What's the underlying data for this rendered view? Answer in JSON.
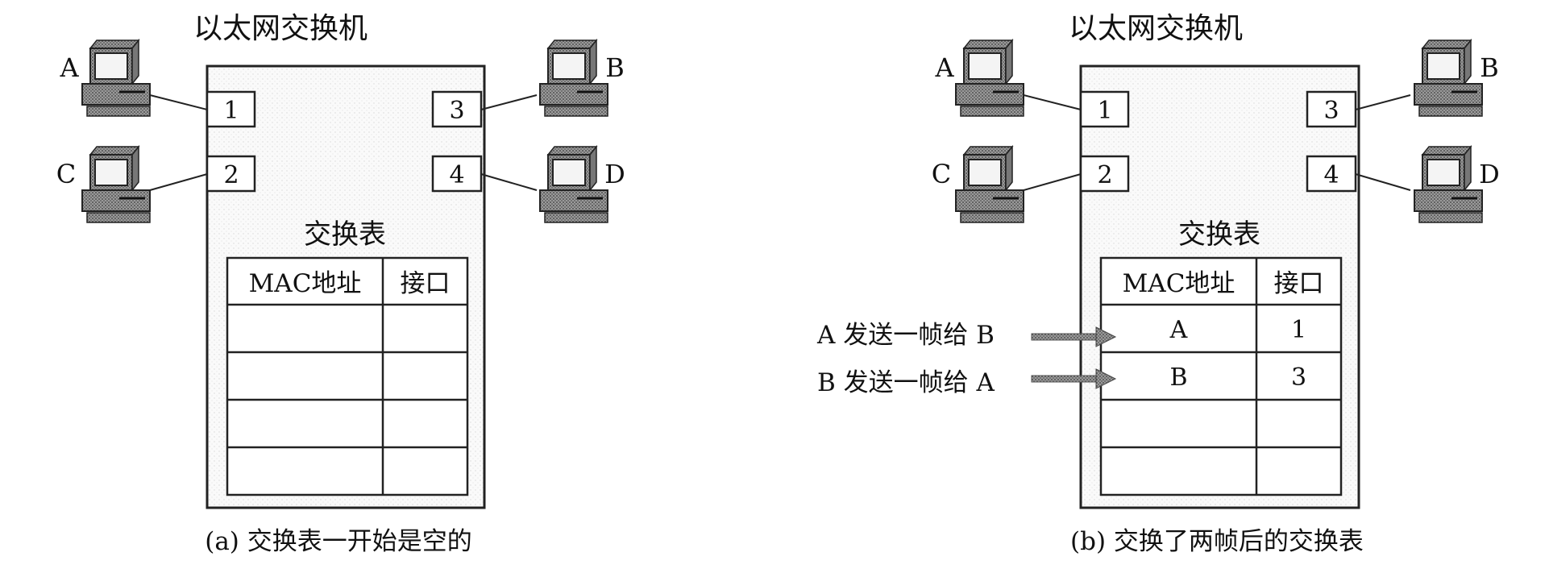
{
  "panels": [
    {
      "switch_title": "以太网交换机",
      "table_title": "交换表",
      "col_mac": "MAC地址",
      "col_port": "接口",
      "caption": "(a) 交换表一开始是空的",
      "rows": [
        {
          "mac": "",
          "port": ""
        },
        {
          "mac": "",
          "port": ""
        },
        {
          "mac": "",
          "port": ""
        },
        {
          "mac": "",
          "port": ""
        }
      ],
      "annotations": []
    },
    {
      "switch_title": "以太网交换机",
      "table_title": "交换表",
      "col_mac": "MAC地址",
      "col_port": "接口",
      "caption": "(b) 交换了两帧后的交换表",
      "rows": [
        {
          "mac": "A",
          "port": "1"
        },
        {
          "mac": "B",
          "port": "3"
        },
        {
          "mac": "",
          "port": ""
        },
        {
          "mac": "",
          "port": ""
        }
      ],
      "annotations": [
        "A 发送一帧给 B",
        "B 发送一帧给 A"
      ]
    }
  ],
  "hosts": [
    {
      "label": "A",
      "port": "1"
    },
    {
      "label": "C",
      "port": "2"
    },
    {
      "label": "B",
      "port": "3"
    },
    {
      "label": "D",
      "port": "4"
    }
  ]
}
